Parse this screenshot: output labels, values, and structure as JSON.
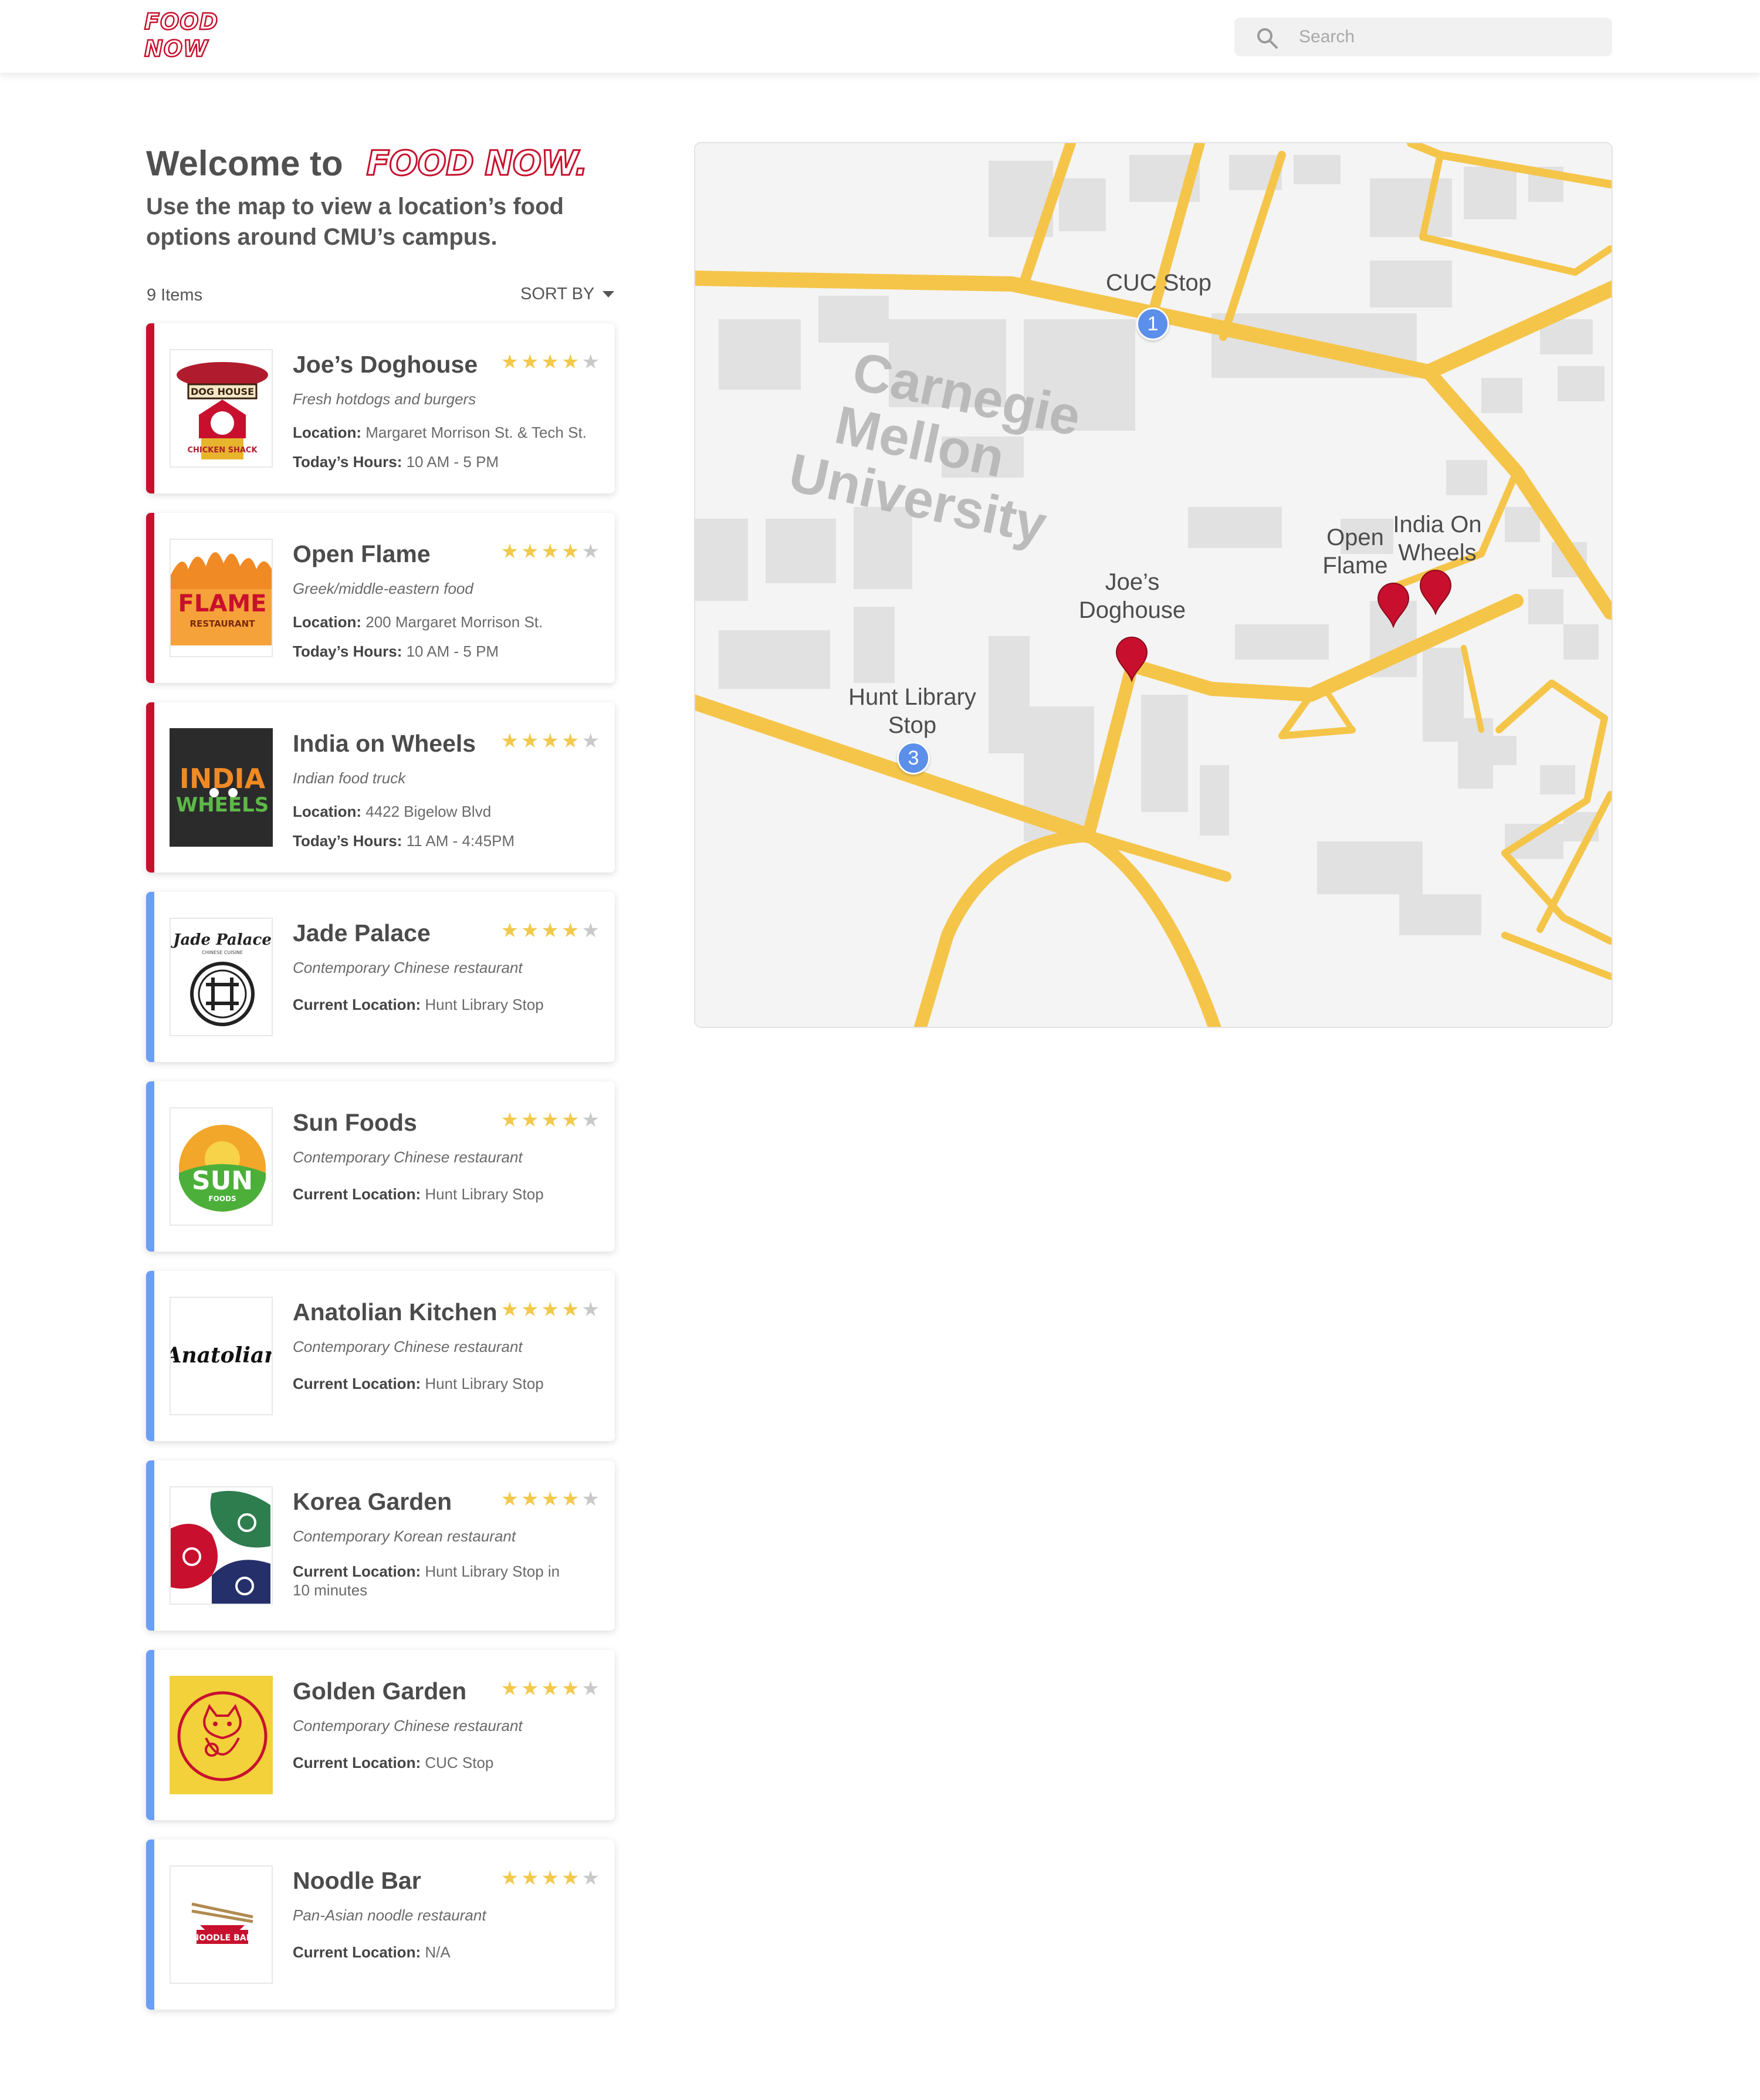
{
  "header": {
    "logo_line1": "FOOD",
    "logo_line2": "NOW",
    "search_placeholder": "Search"
  },
  "intro": {
    "welcome": "Welcome to",
    "brand": "FOOD NOW.",
    "subtitle": "Use the map to view a location’s food options around CMU’s campus.",
    "items_count": "9 Items",
    "sort_label": "SORT BY"
  },
  "colors": {
    "brand_red": "#c8102e",
    "fixed_accent": "#c8102e",
    "truck_accent": "#6b9ef5",
    "star": "#f2c94c",
    "road": "#f5c54a",
    "stop_badge": "#5b8fea"
  },
  "restaurants": [
    {
      "name": "Joe’s Doghouse",
      "rating": 4,
      "desc": "Fresh hotdogs and burgers",
      "line1_label": "Location:",
      "line1_value": "Margaret Morrison St. & Tech St.",
      "line2_label": "Today’s Hours:",
      "line2_value": "10 AM - 5 PM",
      "type": "fixed",
      "logo_text": "DOG HOUSE",
      "logo_sub": "CHICKEN SHACK"
    },
    {
      "name": "Open Flame",
      "rating": 4,
      "desc": "Greek/middle-eastern food",
      "line1_label": "Location:",
      "line1_value": "200 Margaret Morrison St.",
      "line2_label": "Today’s Hours:",
      "line2_value": "10 AM - 5 PM",
      "type": "fixed",
      "logo_text": "FLAME",
      "logo_sub": "RESTAURANT"
    },
    {
      "name": "India on Wheels",
      "rating": 4,
      "desc": "Indian food truck",
      "line1_label": "Location:",
      "line1_value": "4422 Bigelow Blvd",
      "line2_label": "Today’s Hours:",
      "line2_value": "11 AM - 4:45PM",
      "type": "fixed",
      "logo_text": "INDIA",
      "logo_sub": "WHEELS"
    },
    {
      "name": "Jade Palace",
      "rating": 4,
      "desc": "Contemporary Chinese restaurant",
      "line1_label": "Current Location:",
      "line1_value": "Hunt Library Stop",
      "type": "truck",
      "logo_text": "Jade Palace",
      "logo_sub": "CHINESE CUISINE"
    },
    {
      "name": "Sun Foods",
      "rating": 4,
      "desc": "Contemporary Chinese restaurant",
      "line1_label": "Current Location:",
      "line1_value": "Hunt Library Stop",
      "type": "truck",
      "logo_text": "SUN",
      "logo_sub": "FOODS"
    },
    {
      "name": "Anatolian Kitchen",
      "rating": 4,
      "desc": "Contemporary Chinese restaurant",
      "line1_label": "Current Location:",
      "line1_value": "Hunt Library Stop",
      "type": "truck",
      "logo_text": "Anatolian"
    },
    {
      "name": "Korea Garden",
      "rating": 4,
      "desc": "Contemporary Korean restaurant",
      "line1_label": "Current Location:",
      "line1_value": "Hunt Library Stop in 10 minutes",
      "type": "truck"
    },
    {
      "name": "Golden Garden",
      "rating": 4,
      "desc": "Contemporary Chinese restaurant",
      "line1_label": "Current Location:",
      "line1_value": "CUC Stop",
      "type": "truck"
    },
    {
      "name": "Noodle Bar",
      "rating": 4,
      "desc": "Pan-Asian noodle restaurant",
      "line1_label": "Current Location:",
      "line1_value": "N/A",
      "type": "truck",
      "logo_text": "NOODLE BAR"
    }
  ],
  "map": {
    "campus_label_1": "Carnegie",
    "campus_label_2": "Mellon",
    "campus_label_3": "University",
    "stops": [
      {
        "label": "CUC Stop",
        "number": "1"
      },
      {
        "label": "Hunt Library Stop",
        "number": "3"
      }
    ],
    "pins": [
      {
        "label": "Joe’s Doghouse"
      },
      {
        "label": "Open Flame"
      },
      {
        "label": "India On Wheels"
      }
    ]
  }
}
